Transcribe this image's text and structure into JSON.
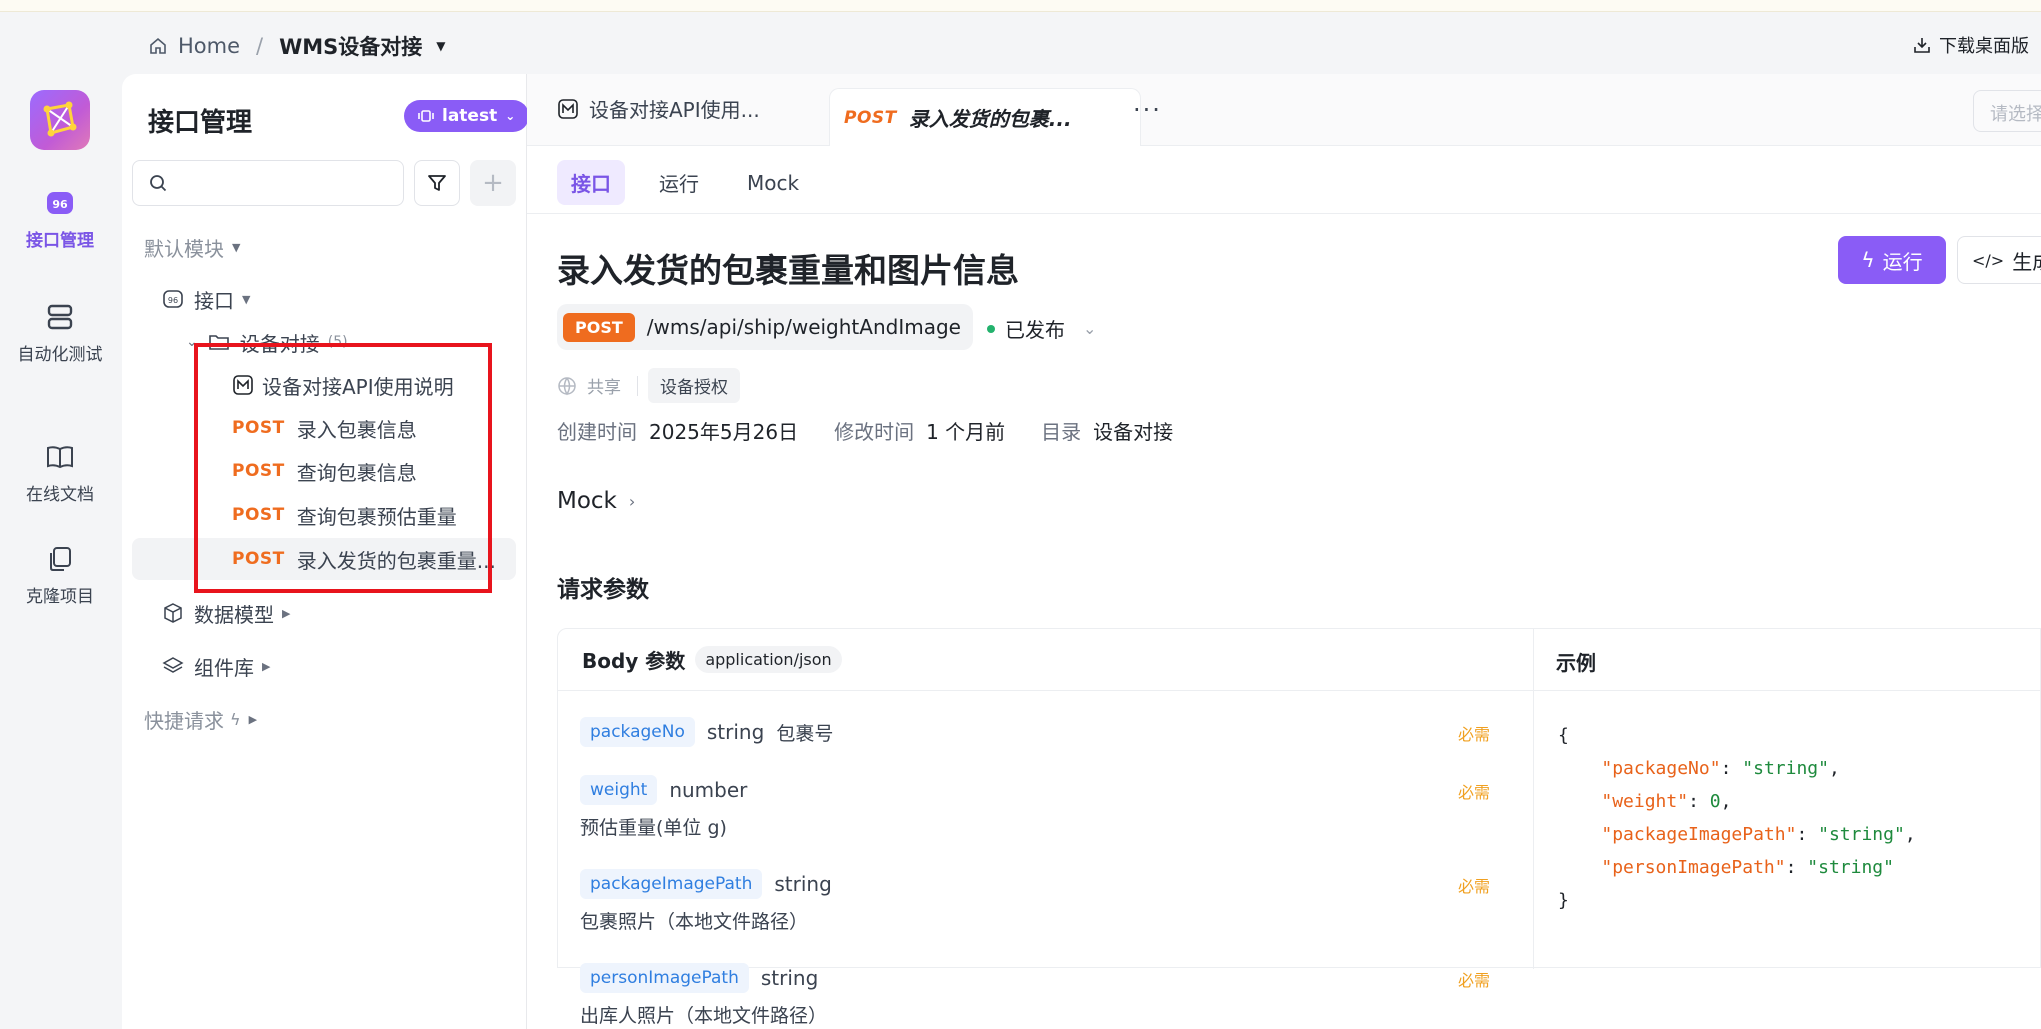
{
  "breadcrumb": {
    "home": "Home",
    "sep": "/",
    "project": "WMS设备对接"
  },
  "header": {
    "download": "下载桌面版"
  },
  "rail": {
    "items": [
      {
        "label": "接口管理"
      },
      {
        "label": "自动化测试"
      },
      {
        "label": "在线文档"
      },
      {
        "label": "克隆项目"
      }
    ]
  },
  "sidebar": {
    "title": "接口管理",
    "version": "latest",
    "search_placeholder": "",
    "default_module": "默认模块",
    "interfaces": "接口",
    "folder": "设备对接",
    "folder_count": "(5)",
    "items": [
      {
        "method": "",
        "label": "设备对接API使用说明"
      },
      {
        "method": "POST",
        "label": "录入包裹信息"
      },
      {
        "method": "POST",
        "label": "查询包裹信息"
      },
      {
        "method": "POST",
        "label": "查询包裹预估重量"
      },
      {
        "method": "POST",
        "label": "录入发货的包裹重量..."
      }
    ],
    "data_models": "数据模型",
    "components": "组件库",
    "quick_request": "快捷请求"
  },
  "tabs": {
    "doc_tab": "设备对接API使用...",
    "active_method": "POST",
    "active_label": "录入发货的包裹...",
    "more": "···",
    "select_placeholder": "请选择"
  },
  "subtabs": [
    "接口",
    "运行",
    "Mock"
  ],
  "api": {
    "title": "录入发货的包裹重量和图片信息",
    "run": "运行",
    "generate": "生成",
    "method": "POST",
    "path": "/wms/api/ship/weightAndImage",
    "status": "已发布",
    "share": "共享",
    "tag": "设备授权",
    "created_label": "创建时间",
    "created": "2025年5月26日",
    "modified_label": "修改时间",
    "modified": "1 个月前",
    "dir_label": "目录",
    "dir": "设备对接",
    "mock": "Mock",
    "request_params": "请求参数",
    "body_label": "Body 参数",
    "content_type": "application/json",
    "example_label": "示例",
    "required": "必需",
    "params": [
      {
        "name": "packageNo",
        "type": "string",
        "desc": "包裹号",
        "desc2": ""
      },
      {
        "name": "weight",
        "type": "number",
        "desc": "",
        "desc2": "预估重量(单位 g)"
      },
      {
        "name": "packageImagePath",
        "type": "string",
        "desc": "",
        "desc2": "包裹照片（本地文件路径）"
      },
      {
        "name": "personImagePath",
        "type": "string",
        "desc": "",
        "desc2": "出库人照片（本地文件路径）"
      }
    ],
    "example": {
      "open": "{",
      "lines": [
        {
          "key": "\"packageNo\"",
          "val": "\"string\"",
          "tail": ","
        },
        {
          "key": "\"weight\"",
          "val": "0",
          "tail": ","
        },
        {
          "key": "\"packageImagePath\"",
          "val": "\"string\"",
          "tail": ","
        },
        {
          "key": "\"personImagePath\"",
          "val": "\"string\"",
          "tail": ""
        }
      ],
      "close": "}"
    }
  }
}
